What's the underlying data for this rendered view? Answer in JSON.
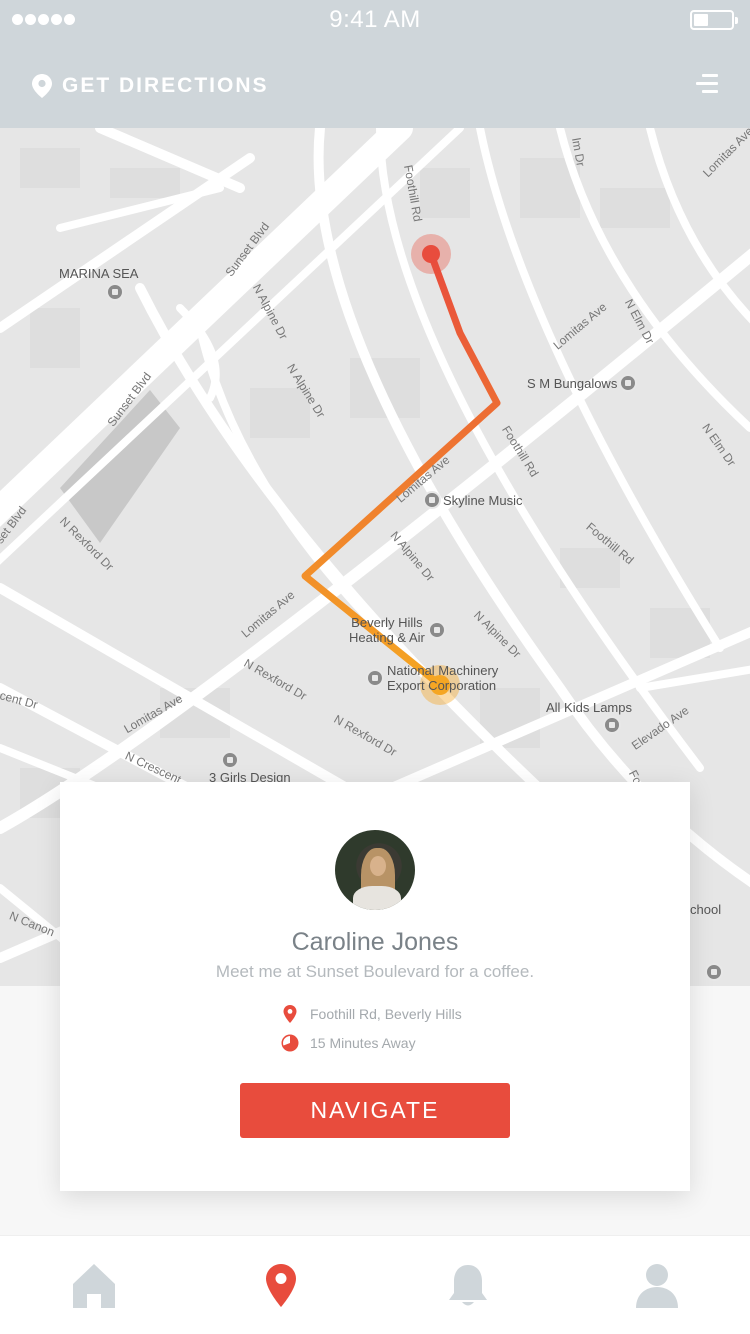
{
  "status_bar": {
    "time": "9:41 AM"
  },
  "header": {
    "title": "GET DIRECTIONS",
    "icons": [
      "location-pin-icon",
      "menu-icon"
    ]
  },
  "map": {
    "places": [
      {
        "label": "MARINA SEA"
      },
      {
        "label": "S M Bungalows"
      },
      {
        "label": "Skyline Music"
      },
      {
        "label": "Beverly Hills\nHeating & Air"
      },
      {
        "label": "National Machinery\nExport Corporation"
      },
      {
        "label": "All Kids Lamps"
      },
      {
        "label": "3 Girls Design"
      },
      {
        "label": "chool"
      }
    ],
    "streets": [
      "Sunset Blvd",
      "Sunset Blvd",
      "set Blvd",
      "Foothill Rd",
      "Foothill Rd",
      "Foothill Rd",
      "N Alpine Dr",
      "N Alpine Dr",
      "N Alpine Dr",
      "N Alpine Dr",
      "Lomitas Ave",
      "Lomitas Ave",
      "Lomitas Ave",
      "Lomitas Ave",
      "N Elm Dr",
      "N Elm Dr",
      "lm Dr",
      "N Rexford Dr",
      "N Rexford Dr",
      "N Rexford Dr",
      "N Crescent",
      "cent Dr",
      "N Canon",
      "Elevado Ave",
      "Lomitas Ave",
      "Foothill Rd"
    ],
    "route_color_start": "#e84c3d",
    "route_color_end": "#f5a623"
  },
  "card": {
    "name": "Caroline Jones",
    "message": "Meet me at Sunset Boulevard for a coffee.",
    "location": "Foothill Rd, Beverly Hills",
    "eta": "15 Minutes Away",
    "button_label": "NAVIGATE",
    "accent_color": "#e84c3d"
  },
  "tabbar": {
    "items": [
      {
        "icon": "home-icon",
        "active": false
      },
      {
        "icon": "location-pin-icon",
        "active": true
      },
      {
        "icon": "bell-icon",
        "active": false
      },
      {
        "icon": "user-icon",
        "active": false
      }
    ]
  }
}
